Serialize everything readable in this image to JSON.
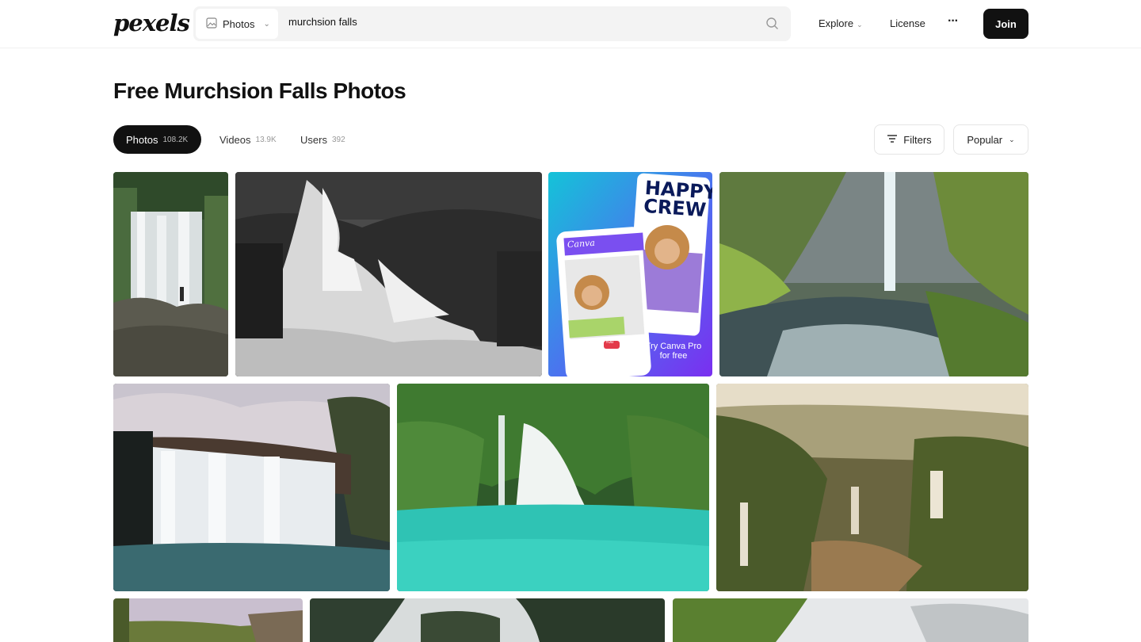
{
  "header": {
    "logo": "pexels",
    "search_type": "Photos",
    "search_value": "murchsion falls",
    "nav_explore": "Explore",
    "nav_license": "License",
    "nav_more": "···",
    "join": "Join"
  },
  "page": {
    "title": "Free Murchsion Falls Photos"
  },
  "tabs": [
    {
      "label": "Photos",
      "count": "108.2K",
      "active": true
    },
    {
      "label": "Videos",
      "count": "13.9K",
      "active": false
    },
    {
      "label": "Users",
      "count": "392",
      "active": false
    }
  ],
  "toolbar": {
    "filters": "Filters",
    "sort": "Popular"
  },
  "ad": {
    "headline_1": "HAPPY",
    "headline_2": "CREW",
    "app_label": "Canva",
    "cta_line1": "Try Canva Pro",
    "cta_line2": "for free",
    "badge": "You"
  },
  "colors": {
    "accent": "#111111",
    "search_bg": "#f3f3f3",
    "ad_gradient_start": "#14c3d8",
    "ad_gradient_end": "#7a2ff0"
  }
}
